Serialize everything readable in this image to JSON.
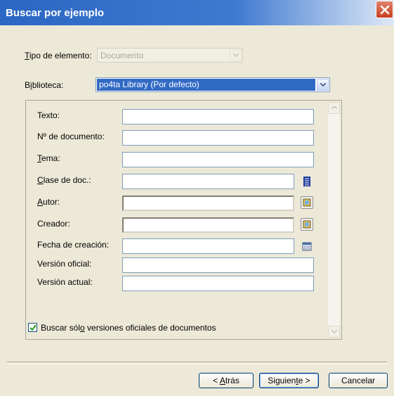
{
  "window": {
    "title": "Buscar por ejemplo"
  },
  "form": {
    "tipo_label_pre": "",
    "tipo_label_u": "T",
    "tipo_label_post": "ipo de elemento:",
    "tipo_value": "Documento",
    "biblioteca_label_pre": "B",
    "biblioteca_label_u": "i",
    "biblioteca_label_post": "blioteca:",
    "biblioteca_value": "po4ta Library  (Por defecto)"
  },
  "fields": {
    "texto": "Texto:",
    "numero": "Nº de documento:",
    "tema_u": "T",
    "tema_post": "ema:",
    "clase_u": "C",
    "clase_post": "lase de doc.:",
    "autor_u": "A",
    "autor_post": "utor:",
    "creador": "Creador:",
    "fecha": "Fecha de creación:",
    "version_oficial": "Versión oficial:",
    "version_actual": "Versión actual:"
  },
  "checkbox": {
    "label_pre": "Buscar sól",
    "label_u": "o",
    "label_post": " versiones oficiales de documentos",
    "checked": true
  },
  "buttons": {
    "atras_pre": "< ",
    "atras_u": "A",
    "atras_post": "trás",
    "siguiente_pre": "Siguien",
    "siguiente_u": "t",
    "siguiente_post": "e >",
    "cancelar": "Cancelar"
  },
  "colors": {
    "title_bar": "#2b67c3",
    "selection": "#316ac5",
    "close_button": "#c8401f"
  }
}
